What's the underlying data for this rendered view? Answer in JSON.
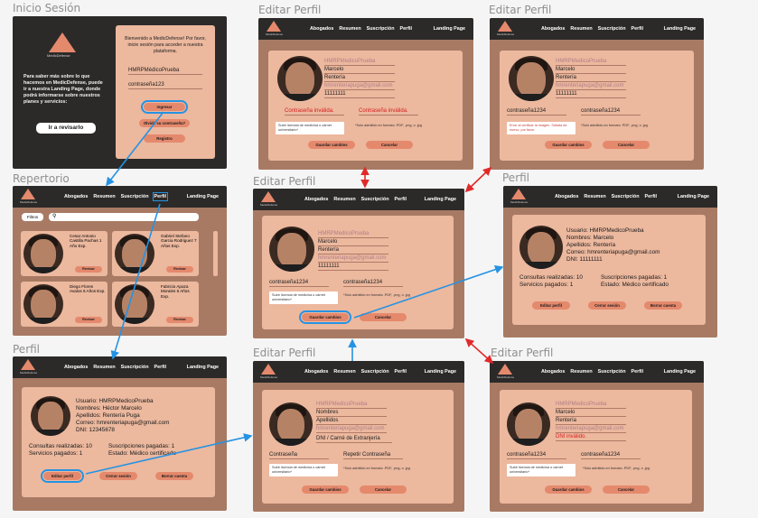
{
  "frames": {
    "login": "Inicio Sesión",
    "repertorio": "Repertorio",
    "perfil_a": "Perfil",
    "editar_a": "Editar Perfil",
    "editar_b": "Editar Perfil",
    "editar_c": "Editar Perfil",
    "perfil_b": "Perfil",
    "editar_d": "Editar Perfil",
    "editar_e": "Editar Perfil"
  },
  "colors": {
    "accent": "#e5896d",
    "card": "#ecb89e",
    "frame": "#a87a64",
    "dark": "#2c2a29",
    "arrow": "#2593e3",
    "arrow_red": "#e02a2a",
    "error": "#d42020"
  },
  "nav": {
    "abogados": "Abogados",
    "resumen": "Resumen",
    "suscripcion": "Suscripción",
    "perfil": "Perfil",
    "landing": "Landing Page",
    "brand": "MedicDefense"
  },
  "login": {
    "brand": "MedicDefense",
    "left_text": "Para saber más sobre lo que hacemos en MedicDefense, puede ir a nuestra Landing Page, donde podrá informarse sobre nuestros planes y servicios:",
    "landing_btn": "Ir a revisarlo",
    "welcome": "Bienvenido a MedicDefense! Por favor, inicie sesión para acceder a nuestra plataforma.",
    "user": "HMRPMédicoPrueba",
    "password": "contraseña123",
    "ingresar": "Ingresar",
    "olvido": "Olvidó su contraseña?",
    "registro": "Registro"
  },
  "repertorio": {
    "filtros": "Filtros",
    "search_icon": "search-icon",
    "abogados": [
      {
        "info": "Cesar Antonio Castilla Pachas 1 Año Exp.",
        "btn": "Revisar"
      },
      {
        "info": "Gabriel Stefano Garcia Rodriguez 7 Años Exp.",
        "btn": "Revisar"
      },
      {
        "info": "Diego Flores Avalos 6 Años Exp.",
        "btn": "Revisar"
      },
      {
        "info": "Fabricio Apaza Morales 6 Años Exp.",
        "btn": "Revisar"
      }
    ]
  },
  "perfil_a": {
    "usuario": "Usuario: HMRPMedicoPrueba",
    "nombres": "Nombres: Héctor Marcelo",
    "apellidos": "Apellidos: Rentería Puga",
    "correo": "Correo: hmrenteriapuga@gmail.com",
    "dni": "DNI: 12345678",
    "consultas": "Consultas realizadas: 10",
    "servicios": "Servicios pagados: 1",
    "suscripciones": "Suscripciones pagadas: 1",
    "estado": "Estado: Médico certificado",
    "editar": "Editar perfil",
    "cerrar": "Cerrar sesión",
    "borrar": "Borrar cuenta"
  },
  "perfil_b": {
    "usuario": "Usuario: HMRPMedicoPrueba",
    "nombres": "Nombres: Marcelo",
    "apellidos": "Apellidos: Rentería",
    "correo": "Correo: hmrenteriapuga@gmail.com",
    "dni": "DNI: 11111111",
    "consultas": "Consultas realizadas: 10",
    "servicios": "Servicios pagados: 1",
    "suscripciones": "Suscripciones pagadas: 1",
    "estado": "Estado: Médico certificado",
    "editar": "Editar perfil",
    "cerrar": "Cerrar sesión",
    "borrar": "Borrar cuenta"
  },
  "edit": {
    "username": "HMRPMedicoPrueba",
    "nombre": "Marcelo",
    "apellido": "Rentería",
    "correo": "hmrenteriapuga@gmail.com",
    "dni": "11111111",
    "pass1": "contraseña1234",
    "pass2": "contraseña1234",
    "pass_inv": "Contraseña inválida.",
    "upload": "Subir licencia de medicina o cárnet universitario*",
    "upload_err": "Error al verificar la imagen. Súbala de nuevo, por favor.",
    "note": "*Solo admitido en formato .PDF, .png, o .jpg",
    "guardar": "Guardar cambios",
    "cancelar": "Cancelar",
    "dni_inv": "DNI inválido.",
    "blank_username": "HMRPMedicoPrueba",
    "blank_nombres": "Nombres",
    "blank_apellidos": "Apellidos",
    "blank_correo": "hmrenteriapuga@gmail.com",
    "blank_dni": "DNI / Carné de Extranjería",
    "blank_pass": "Contraseña",
    "blank_repeat": "Repetir Contraseña"
  }
}
